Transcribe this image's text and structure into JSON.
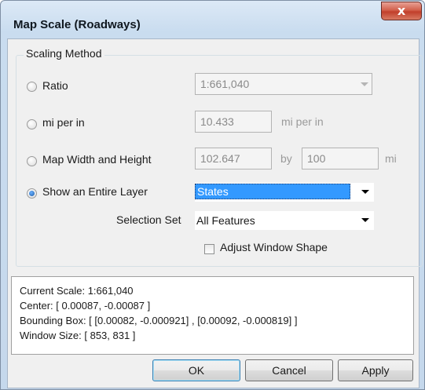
{
  "window": {
    "title": "Map Scale (Roadways)",
    "close_glyph": "x"
  },
  "group": {
    "legend": "Scaling Method"
  },
  "methods": {
    "ratio": {
      "label": "Ratio",
      "value": "1:661,040",
      "checked": false
    },
    "mi_per_in": {
      "label": "mi per in",
      "value": "10.433",
      "unit": "mi per in",
      "checked": false
    },
    "width_height": {
      "label": "Map Width and Height",
      "width": "102.647",
      "by": "by",
      "height": "100",
      "unit": "mi",
      "checked": false
    },
    "entire_layer": {
      "label": "Show an Entire Layer",
      "value": "States",
      "checked": true
    }
  },
  "selection_set": {
    "label": "Selection Set",
    "value": "All Features"
  },
  "adjust_window": {
    "label": "Adjust Window Shape",
    "checked": false
  },
  "info": {
    "current_scale": "Current Scale: 1:661,040",
    "center": "Center: [ 0.00087, -0.00087 ]",
    "bounding_box": "Bounding Box: [ [0.00082, -0.000921] , [0.00092, -0.000819] ]",
    "window_size": "Window Size: [ 853, 831 ]"
  },
  "buttons": {
    "ok": "OK",
    "cancel": "Cancel",
    "apply": "Apply"
  },
  "icons": {
    "close": "close-icon",
    "dropdown": "chevron-down-icon"
  }
}
